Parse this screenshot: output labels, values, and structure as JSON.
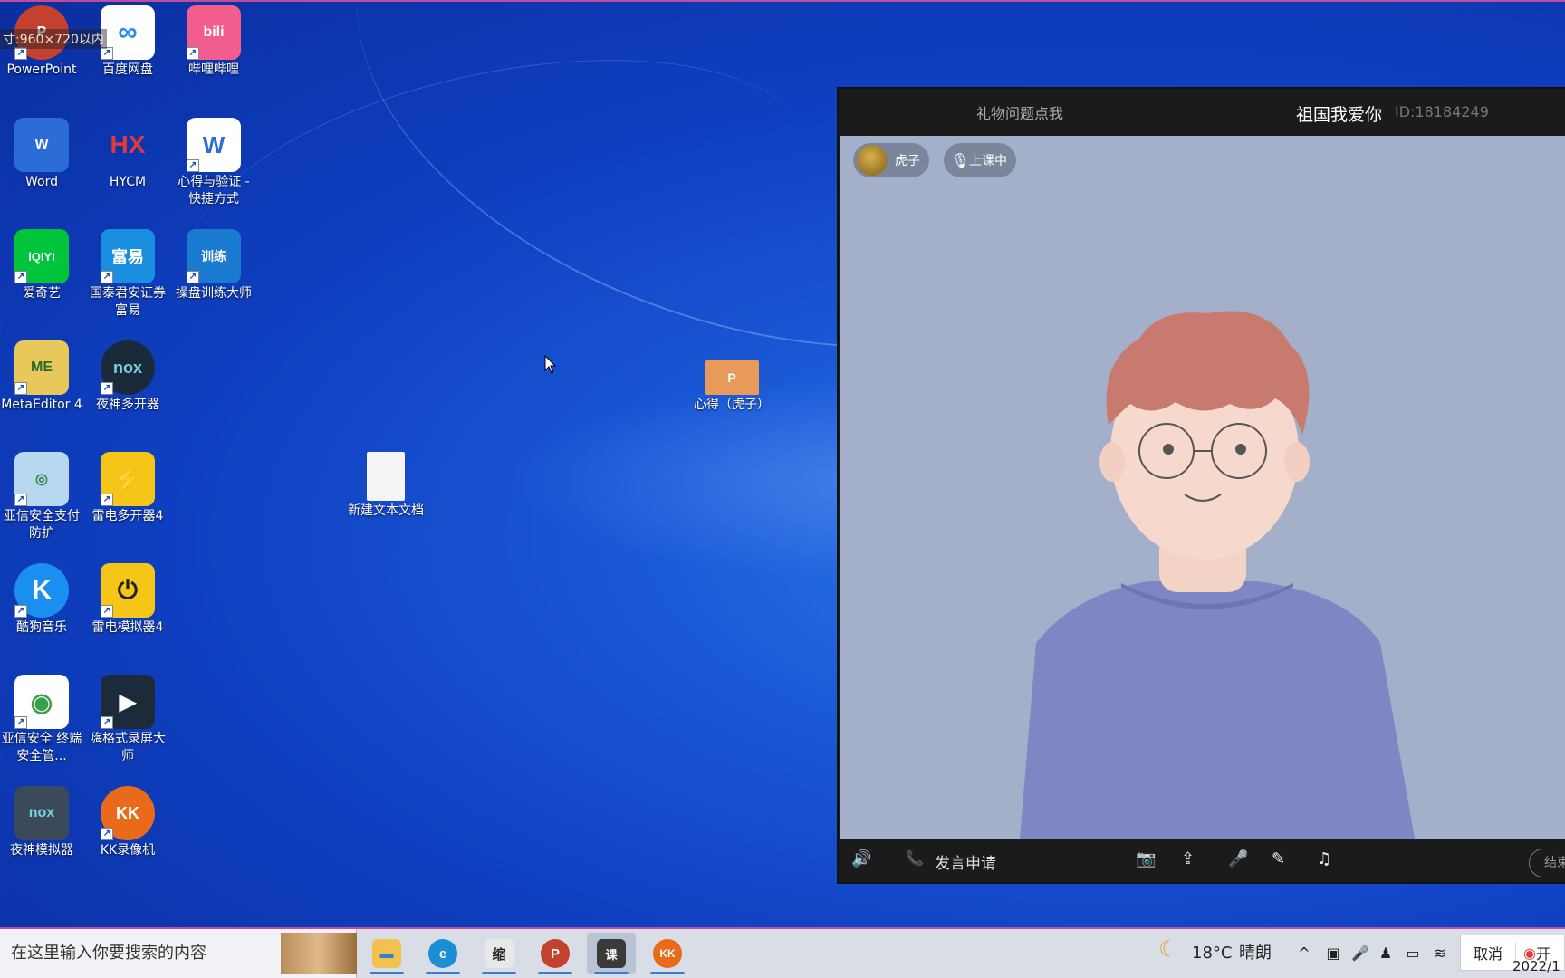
{
  "overlay": {
    "size_tip": "寸:960×720以内"
  },
  "desktop_icons": [
    {
      "label": "PowerPoint",
      "icon": "powerpoint-icon",
      "color": "#c4402f",
      "glyph": "P"
    },
    {
      "label": "百度网盘",
      "icon": "baidu-netdisk-icon",
      "color": "#ffffff",
      "glyph": "∞"
    },
    {
      "label": "哔哩哔哩",
      "icon": "bilibili-icon",
      "color": "#f25d8e",
      "glyph": "bili"
    },
    {
      "label": "Word",
      "icon": "word-icon",
      "color": "#2b6cd6",
      "glyph": "W"
    },
    {
      "label": "HYCM",
      "icon": "hycm-icon",
      "color": "#1a58d6",
      "glyph": "HX"
    },
    {
      "label": "心得与验证 - 快捷方式",
      "icon": "word-doc-shortcut-icon",
      "color": "#ffffff",
      "glyph": "W"
    },
    {
      "label": "爱奇艺",
      "icon": "iqiyi-icon",
      "color": "#00c43a",
      "glyph": "iQIYI"
    },
    {
      "label": "国泰君安证券富易",
      "icon": "guotai-fuyi-icon",
      "color": "#1a8fe0",
      "glyph": "富易"
    },
    {
      "label": "操盘训练大师",
      "icon": "trading-trainer-icon",
      "color": "#1a7ad0",
      "glyph": "训练"
    },
    {
      "label": "MetaEditor 4",
      "icon": "metaeditor-icon",
      "color": "#e8c85a",
      "glyph": "ME"
    },
    {
      "label": "夜神多开器",
      "icon": "nox-multi-icon",
      "color": "#1a2a3a",
      "glyph": "nox"
    },
    {
      "label": "亚信安全支付防护",
      "icon": "asiainfo-pay-icon",
      "color": "#b8d8f0",
      "glyph": "◎"
    },
    {
      "label": "雷电多开器4",
      "icon": "ldplayer-multi-icon",
      "color": "#f5c518",
      "glyph": "⚡"
    },
    {
      "label": "酷狗音乐",
      "icon": "kugou-icon",
      "color": "#1a8ff0",
      "glyph": "K"
    },
    {
      "label": "雷电模拟器4",
      "icon": "ldplayer-icon",
      "color": "#f5c518",
      "glyph": "⏻"
    },
    {
      "label": "亚信安全 终端安全管...",
      "icon": "asiainfo-endpoint-icon",
      "color": "#ffffff",
      "glyph": "◉"
    },
    {
      "label": "嗨格式录屏大师",
      "icon": "hi-recorder-icon",
      "color": "#1c2a3a",
      "glyph": "▶"
    },
    {
      "label": "夜神模拟器",
      "icon": "nox-player-icon",
      "color": "#3a4a5a",
      "glyph": "nox"
    },
    {
      "label": "KK录像机",
      "icon": "kk-recorder-icon",
      "color": "#e86a1a",
      "glyph": "KK"
    },
    {
      "label": "新建文本文档",
      "icon": "text-file-icon",
      "color": "#f4f4f4",
      "glyph": ""
    },
    {
      "label": "心得（虎子）",
      "icon": "pptx-file-icon",
      "color": "#e89a5a",
      "glyph": "P"
    }
  ],
  "live_window": {
    "gift_link": "礼物问题点我",
    "title": "祖国我爱你",
    "room_id": "ID:18184249",
    "teacher_name": "虎子",
    "status": "上课中",
    "apply_speak": "发言申请",
    "end_button": "结束"
  },
  "taskbar": {
    "search_placeholder": "在这里输入你要搜索的内容",
    "apps": [
      {
        "name": "file-explorer",
        "icon": "folder-icon",
        "color": "#f2c14e",
        "glyph": "▬"
      },
      {
        "name": "edge",
        "icon": "edge-icon",
        "color": "#1a8fd6",
        "glyph": "e"
      },
      {
        "name": "calligraphy",
        "icon": "calligraphy-app-icon",
        "color": "#e8e8e8",
        "glyph": "缩"
      },
      {
        "name": "powerpoint",
        "icon": "powerpoint-icon",
        "color": "#c4402f",
        "glyph": "P"
      },
      {
        "name": "class-app",
        "icon": "class-app-icon",
        "color": "#3a3a3a",
        "glyph": "课"
      },
      {
        "name": "kk-recorder",
        "icon": "kk-recorder-icon",
        "color": "#e86a1a",
        "glyph": "KK"
      }
    ],
    "weather_temp": "18°C",
    "weather_desc": "晴朗",
    "cancel_label": "取消",
    "open_label": "开",
    "clock_fragment": "2022/1"
  }
}
